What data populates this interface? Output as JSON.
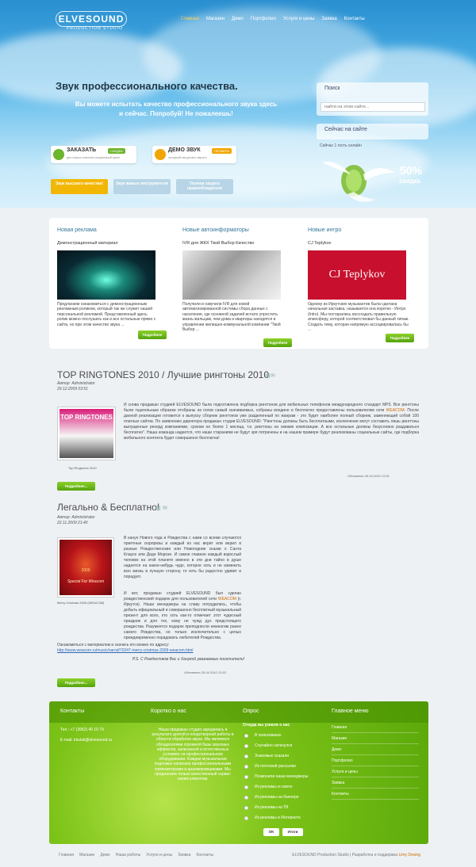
{
  "logo": {
    "name": "ELVESOUND",
    "subtitle": "PRODUCTION STUDIO"
  },
  "nav": [
    "Главная",
    "Магазин",
    "Демо",
    "Портфолио",
    "Услуги и цены",
    "Заявка",
    "Контакты"
  ],
  "hero": {
    "title": "Звук профессионального качества.",
    "subtitle": "Вы можете испытать качество профессионального звука здесь и сейчас. Попробуй! Не пожалеешь!",
    "order_btn": {
      "title": "ЗАКАЗАТЬ",
      "badge": "СКИДКА",
      "sub": "для старых клиентов специальный купон"
    },
    "demo_btn": {
      "title": "ДЕМО ЗВУК",
      "badge": "ПРОВЕРЬ",
      "sub": "послушай как должно звучать"
    }
  },
  "tabs": [
    "Звук высшего качества!",
    "Звук живых инструментов",
    "Полная защита правообладателя"
  ],
  "sidebar": {
    "search_title": "Поиск",
    "search_placeholder": "найти на этом сайте...",
    "online_title": "Сейчас на сайте",
    "online_text": "Сейчас 1 гость онлайн",
    "promo_percent": "50%",
    "promo_label": "скидка"
  },
  "cards": [
    {
      "heading": "Новая реклама",
      "caption": "Демонстрационный материал",
      "text": "Предлагаем ознакомиться с демонстрационным рекламным роликом, который так же служит нашей персональной рекламой. Представленный здесь ролик можно послушать как и все остальные прямо с сайта, но при этом качество звука ...",
      "btn": "Подробнее"
    },
    {
      "heading": "Новые автоинформаторы",
      "caption": "IVR для ЖКХ Твой Выбор Качество",
      "text": "Получили и озвучили IVR для новой автоматизированной системы сбора данных с населения, где основной задачей встало упростить жизнь жильцам, чем дома и квартиры находятся в управлении жилищно-коммунальной компании \"Твой Выбор ...",
      "btn": "Подробнее"
    },
    {
      "heading": "Новые интро",
      "caption": "CJ Teplykov",
      "img_text": "CJ Teplykov",
      "text": "Одному из Иркутских музыкантов была сделана начальная заставка, называется она коротко - Интро (Intro). Мы постарались воссоздать правильную атмосферу, которой соответствовал бы данный типаж. Создать тему, которая напрямую ассоциировалась бы ...",
      "btn": "Подробнее"
    }
  ],
  "articles": [
    {
      "title": "TOP RINGTONES 2010 / Лучшие рингтоны 2010",
      "author": "Автор: Administrator",
      "date": "29.12.2009 03:51",
      "image_caption": "Top Ringtones 2010",
      "image_text": "TOP RINGTONES",
      "body_before": "И снова продакшн студией ELVESOUND была подготовлена подборка рингтонов для мобильных телефонов международного стандарт MP3. Все рингтоны были тщательным образом отобраны из голов самый скачиваемых, собраны воедино и бесплатно предоставлены пользователям сети ",
      "body_link": "WEACOM",
      "body_after": ". После данной реализации готовится к выпуску сборник рингтонов уже разделенный по жанрам - это будет наиболее полный сборник, заменяющий собой 100 платных сайтов. По заявлению директора продакшн студии ELVESOUND: \"Рингтоны должны быть бесплатными, исключение могут составить лишь рингтоны выпущенные рекорд компаниями, сроком не более 1 месяца, т.е. рингтоны на свежие композиции. А все остальные должны безусловно раздаваться бесплатно\". Наша команда надеется, что наши стараниям не будут зря потрачены и на нашем примере будут реализованы социальные сайты, где подборка мобильного контента будет совершенно бесплатна!",
      "modified": "Обновлено 28.04.2010 13:51",
      "btn": "Подробнее..."
    },
    {
      "title": "Легально & Бесплатно!",
      "author": "Автор: Administrator",
      "date": "22.11.2009 21:40",
      "image_caption": "Merry Cristmas 2009 (WEACOM)",
      "image_text": "Special For Weacom",
      "image_year": "2009",
      "p1": "В канун Нового года и Рождества с нами со всеми случаются приятные сюрпризы и каждый из нас верит или верил в разные Рождественские или Новогодние сказки о Санта Клаусе или Деде Морозе. И самое главное каждый взрослый человек на этой планете именно в эти дни тайно в душе надеется на какое-нибудь чудо, которое хоть и не изменить всю жизнь в лучшую сторону, то хоть бы радостно удивит и порадует.",
      "p2_before": "И вот, продакшн студией ELVESOUND был сделан рождественский подарок для пользователей сети ",
      "p2_link": "WEACOM",
      "p2_after": " (г. Иркутск). Наши менеджеры на славу потрудились, чтобы добыть официальный и совершенно бесплатный музыкальный презент для всех, кто хоть как-то отмечает этот чудесный праздник и для тех, кому не чужд дух предстоящего рождества. Разумеется подарок преподнесли немногим ранее самого Рождества, но только исключительно с целью преждевременно порадовать любителей Рождества.",
      "p3": "Ознакомиться с материалом и скачать его можно по адресу:",
      "url": "http://www.weacom.ru/music/narod/70247-merry-cristmas-2009-weacom.html",
      "ps": "P.S. С Рождеством Вас и Ханукой уважаемые посетители!",
      "modified": "Обновлено 28.04.2010 13:53",
      "btn": "Подробнее..."
    }
  ],
  "footer": {
    "contacts_title": "Контакты",
    "tel": "Тел.: +7 (3952) 40 10 79",
    "email": "E-mail: irkutsk@elvesound.ru",
    "about_title": "Коротко о нас",
    "about_text": "Наша продакшн студия зародилась в результате долгой и плодотворной работы в области обработки звука. Мы являемся обладателями огромной базы звуковых эффектов, записанной в естественных условиях на профессиональном оборудовании. Каждая музыкальная подложка написана профессиональными композиторами и аранжировщиками. Мы предлагаем только качественный сервис своим клиентам.",
    "poll_title": "Опрос",
    "poll_question": "Откуда вы узнали о нас",
    "poll_options": [
      "В поисковиках",
      "Случайно наткнулся",
      "Знакомые сказали",
      "Из почтовой рассылки",
      "Позвонили наши менеджеры",
      "Из рекламы в газете",
      "Из рекламы на баннере",
      "Из рекламы на ТВ",
      "Из рекламы в Интернете"
    ],
    "poll_ok": "OK",
    "poll_results": "Итоги",
    "menu_title": "Главное меню",
    "menu": [
      "Главная",
      "Магазин",
      "Демо",
      "Портфолио",
      "Услуги и цены",
      "Заявка",
      "Контакты"
    ]
  },
  "bottom": {
    "nav": [
      "Главная",
      "Магазин",
      "Демо",
      "Наши работы",
      "Услуги и цены",
      "Заявка",
      "Контакты"
    ],
    "copyright_prefix": "ELVESOUND Production Studio | Разработка и поддержка ",
    "copyright_link": "Limy Desing"
  }
}
